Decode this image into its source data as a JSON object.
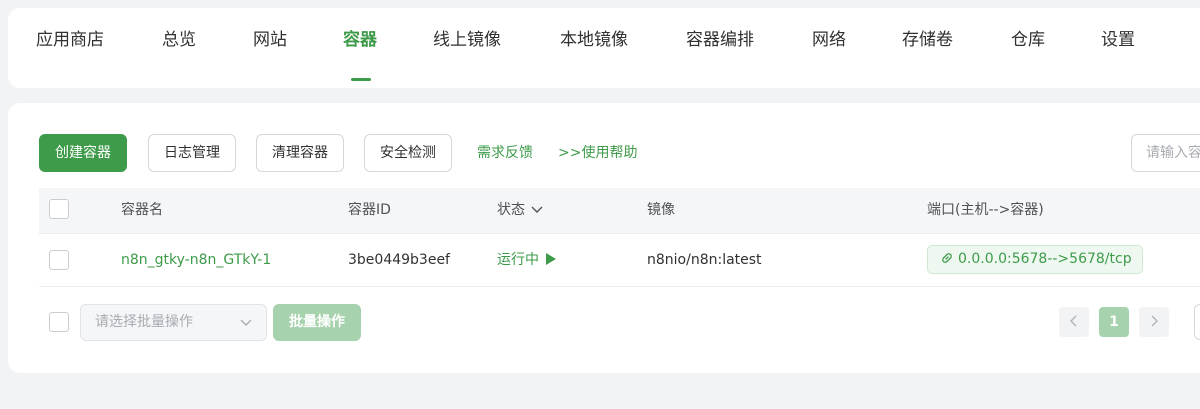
{
  "nav": {
    "tabs": [
      {
        "label": "应用商店"
      },
      {
        "label": "总览"
      },
      {
        "label": "网站"
      },
      {
        "label": "容器"
      },
      {
        "label": "线上镜像"
      },
      {
        "label": "本地镜像"
      },
      {
        "label": "容器编排"
      },
      {
        "label": "网络"
      },
      {
        "label": "存储卷"
      },
      {
        "label": "仓库"
      },
      {
        "label": "设置"
      }
    ],
    "active_tab": "容器"
  },
  "toolbar": {
    "create_label": "创建容器",
    "logs_label": "日志管理",
    "clean_label": "清理容器",
    "security_label": "安全检测",
    "feedback_link": "需求反馈",
    "help_link": ">>使用帮助",
    "search_placeholder": "请输入容"
  },
  "table": {
    "columns": [
      "容器名",
      "容器ID",
      "状态",
      "镜像",
      "端口(主机-->容器)"
    ],
    "status_sort_icon": "chevron-down-icon",
    "rows": [
      {
        "name": "n8n_gtky-n8n_GTkY-1",
        "id": "3be0449b3eef",
        "status": "运行中",
        "image": "n8nio/n8n:latest",
        "port": "0.0.0.0:5678-->5678/tcp"
      }
    ]
  },
  "footer": {
    "batch_select_placeholder": "请选择批量操作",
    "batch_button_label": "批量操作",
    "current_page": "1",
    "prev_icon": "chevron-left-icon",
    "next_icon": "chevron-right-icon"
  },
  "colors": {
    "accent": "#3e9b4a",
    "background": "#f2f3f5",
    "table_header_bg": "#f5f6f8"
  }
}
